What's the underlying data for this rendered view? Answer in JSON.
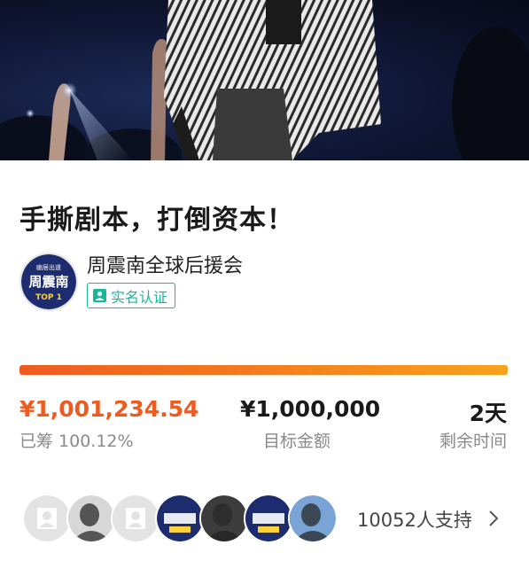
{
  "title": "手撕剧本，打倒资本！",
  "organizer": {
    "name": "周震南全球后援会",
    "verified_label": "实名认证",
    "logo_text_top": "幽居出道",
    "logo_text_mid": "周震南",
    "logo_text_bottom": "TOP 1"
  },
  "progress": {
    "fraction": 1.0
  },
  "stats": {
    "raised_value": "¥1,001,234.54",
    "raised_label": "已筹 100.12%",
    "goal_value": "¥1,000,000",
    "goal_label": "目标金额",
    "days_value": "2天",
    "days_label": "剩余时间"
  },
  "supporters": {
    "count_label": "10052人支持",
    "avatars": [
      "default",
      "photo",
      "default",
      "logo",
      "photo",
      "logo",
      "photo"
    ]
  },
  "icons": {
    "verified": "person-icon",
    "chevron": "chevron-right-icon"
  },
  "colors": {
    "accent": "#ef5a1f",
    "verified": "#17b79a",
    "logo_bg": "#1d2c6e"
  }
}
